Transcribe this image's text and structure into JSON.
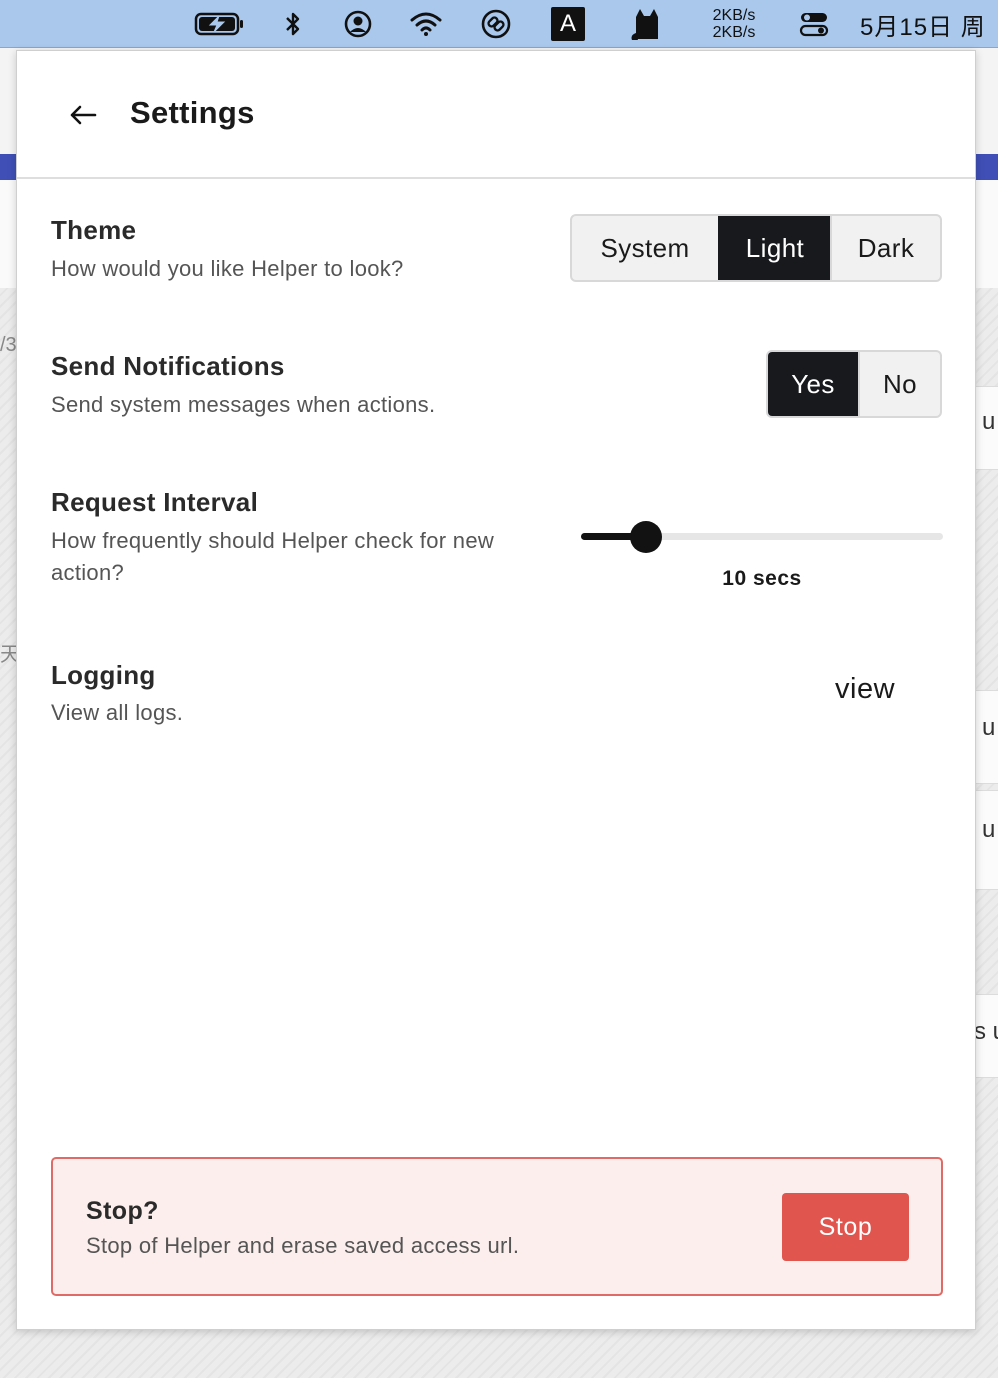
{
  "menubar": {
    "net_up": "2KB/s",
    "net_down": "2KB/s",
    "input_method": "A",
    "datetime": "5月15日 周"
  },
  "background": {
    "frag_1": "/3",
    "frag_2": "天",
    "frag_3": "u",
    "frag_4": "u",
    "frag_5": "u",
    "frag_6": "s u"
  },
  "header": {
    "title": "Settings"
  },
  "theme": {
    "title": "Theme",
    "description": "How would you like Helper to look?",
    "options": [
      "System",
      "Light",
      "Dark"
    ],
    "selected": "Light"
  },
  "notifications": {
    "title": "Send Notifications",
    "description": "Send system messages when actions.",
    "options": [
      "Yes",
      "No"
    ],
    "selected": "Yes"
  },
  "request_interval": {
    "title": "Request Interval",
    "description": "How frequently should Helper check for new action?",
    "value_label": "10 secs",
    "value_fraction": 0.18
  },
  "logging": {
    "title": "Logging",
    "description": "View all logs.",
    "link_label": "view"
  },
  "danger_zone": {
    "title": "Stop?",
    "description": "Stop of Helper and erase saved access url.",
    "button_label": "Stop"
  },
  "colors": {
    "accent_dark": "#17191d",
    "danger": "#e0554e",
    "danger_bg": "#fbeeec",
    "menubar": "#a9c8ec"
  }
}
